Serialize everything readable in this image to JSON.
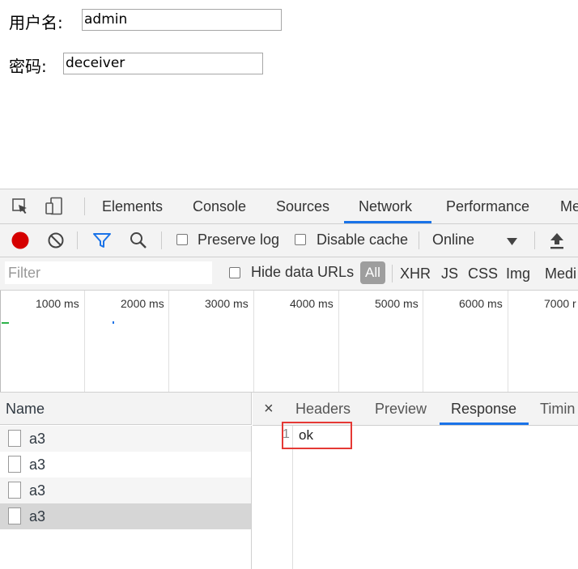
{
  "form": {
    "username_label": "用户名:",
    "username_value": "admin",
    "password_label": "密码:",
    "password_value": "deceiver"
  },
  "devtools": {
    "tabs": [
      {
        "label": "Elements"
      },
      {
        "label": "Console"
      },
      {
        "label": "Sources"
      },
      {
        "label": "Network",
        "active": true
      },
      {
        "label": "Performance"
      },
      {
        "label": "Me"
      }
    ],
    "toolbar": {
      "preserve_log": "Preserve log",
      "disable_cache": "Disable cache",
      "throttle": "Online"
    },
    "filterbar": {
      "filter_placeholder": "Filter",
      "hide_data_urls": "Hide data URLs",
      "types": [
        "All",
        "XHR",
        "JS",
        "CSS",
        "Img",
        "Medi"
      ]
    },
    "timeline": {
      "ticks": [
        "1000 ms",
        "2000 ms",
        "3000 ms",
        "4000 ms",
        "5000 ms",
        "6000 ms",
        "7000 r"
      ]
    },
    "requests": {
      "column_name": "Name",
      "rows": [
        {
          "name": "a3"
        },
        {
          "name": "a3"
        },
        {
          "name": "a3"
        },
        {
          "name": "a3",
          "selected": true
        }
      ]
    },
    "detail": {
      "close": "×",
      "tabs": [
        "Headers",
        "Preview",
        "Response",
        "Timin"
      ],
      "active_tab": "Response",
      "response_line_number": "1",
      "response_body": "ok"
    },
    "colors": {
      "accent": "#1a73e8",
      "record": "#d50000",
      "highlight_box": "#e53935"
    }
  }
}
